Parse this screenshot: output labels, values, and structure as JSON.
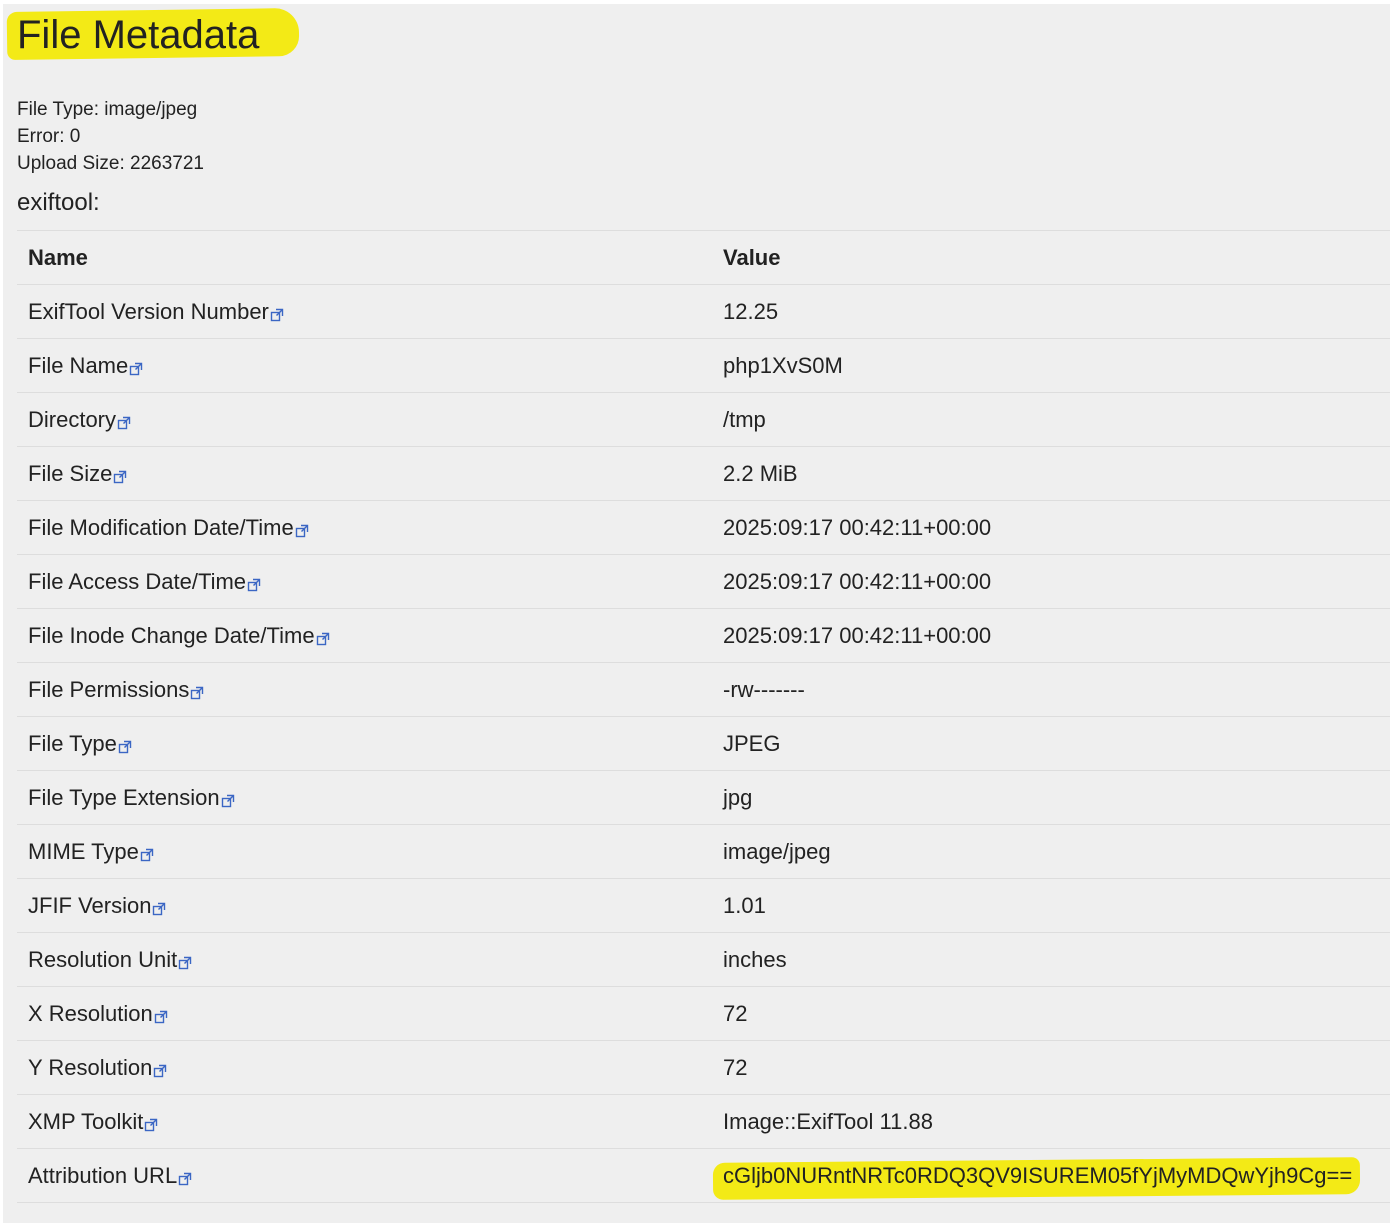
{
  "page": {
    "title": "File Metadata",
    "file_type_line": "File Type: image/jpeg",
    "error_line": "Error: 0",
    "upload_size_line": "Upload Size: 2263721",
    "section_label": "exiftool:"
  },
  "table": {
    "headers": {
      "name": "Name",
      "value": "Value"
    },
    "rows": [
      {
        "name": "ExifTool Version Number",
        "value": "12.25"
      },
      {
        "name": "File Name",
        "value": "php1XvS0M"
      },
      {
        "name": "Directory",
        "value": "/tmp"
      },
      {
        "name": "File Size",
        "value": "2.2 MiB"
      },
      {
        "name": "File Modification Date/Time",
        "value": "2025:09:17 00:42:11+00:00"
      },
      {
        "name": "File Access Date/Time",
        "value": "2025:09:17 00:42:11+00:00"
      },
      {
        "name": "File Inode Change Date/Time",
        "value": "2025:09:17 00:42:11+00:00"
      },
      {
        "name": "File Permissions",
        "value": "-rw-------"
      },
      {
        "name": "File Type",
        "value": "JPEG"
      },
      {
        "name": "File Type Extension",
        "value": "jpg"
      },
      {
        "name": "MIME Type",
        "value": "image/jpeg"
      },
      {
        "name": "JFIF Version",
        "value": "1.01"
      },
      {
        "name": "Resolution Unit",
        "value": "inches"
      },
      {
        "name": "X Resolution",
        "value": "72"
      },
      {
        "name": "Y Resolution",
        "value": "72"
      },
      {
        "name": "XMP Toolkit",
        "value": "Image::ExifTool 11.88"
      },
      {
        "name": "Attribution URL",
        "value": "cGljb0NURntNRTc0RDQ3QV9ISUREM05fYjMyMDQwYjh9Cg=="
      }
    ]
  },
  "icons": {
    "external_link": "external-link-icon"
  },
  "colors": {
    "page_background": "#efefef",
    "highlight": "#f3ea16",
    "link_icon": "#3b66c4",
    "border": "#dddddd"
  }
}
